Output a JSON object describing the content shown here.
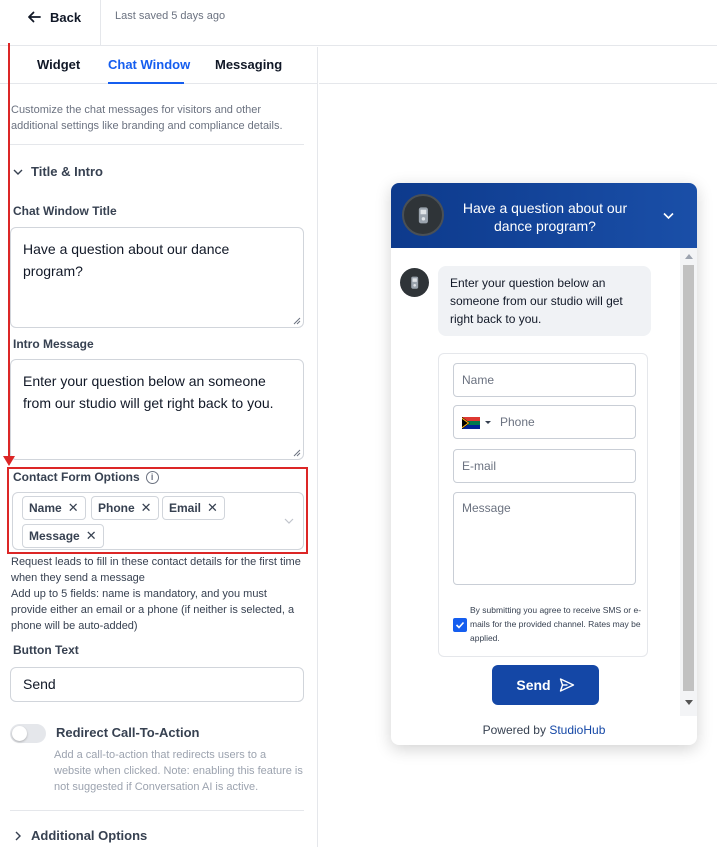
{
  "topbar": {
    "back_label": "Back",
    "last_saved": "Last saved 5 days ago"
  },
  "tabs": [
    {
      "label": "Widget"
    },
    {
      "label": "Chat Window"
    },
    {
      "label": "Messaging"
    }
  ],
  "active_tab": "Chat Window",
  "settings": {
    "description": "Customize the chat messages for visitors and other additional settings like branding and compliance details.",
    "title_intro_section": "Title & Intro",
    "chat_window_title_label": "Chat Window Title",
    "chat_window_title_value": "Have a question about our dance program?",
    "intro_message_label": "Intro Message",
    "intro_message_value": "Enter your question below an someone from our studio will get right back to you.",
    "contact_form_label": "Contact Form Options",
    "contact_form_tags": [
      "Name",
      "Phone",
      "Email",
      "Message"
    ],
    "help_1": "Request leads to fill in these contact details for the first time when they send a message",
    "help_2": "Add up to 5 fields: name is mandatory, and you must provide either an email or a phone (if neither is selected, a phone will be auto-added)",
    "button_text_label": "Button Text",
    "button_text_value": "Send",
    "redirect_label": "Redirect Call-To-Action",
    "redirect_enabled": false,
    "redirect_desc": "Add a call-to-action that redirects users to a website when clicked. Note: enabling this feature is not suggested if Conversation AI is active.",
    "additional_options": "Additional Options"
  },
  "preview": {
    "header_title": "Have a question about our dance program?",
    "intro_bubble": "Enter your question below an someone from our studio will get right back to you.",
    "name_placeholder": "Name",
    "phone_placeholder": "Phone",
    "email_placeholder": "E-mail",
    "message_placeholder": "Message",
    "consent_checked": true,
    "consent_text": "By submitting you agree to receive SMS or e-mails for the provided channel. Rates may be applied.",
    "send_label": "Send",
    "powered_prefix": "Powered by",
    "powered_brand": "StudioHub"
  },
  "colors": {
    "accent": "#155eef",
    "header_start": "#0d3a8c",
    "header_end": "#1a4fa8",
    "send_button": "#1447a6",
    "highlight": "#dc2626"
  }
}
